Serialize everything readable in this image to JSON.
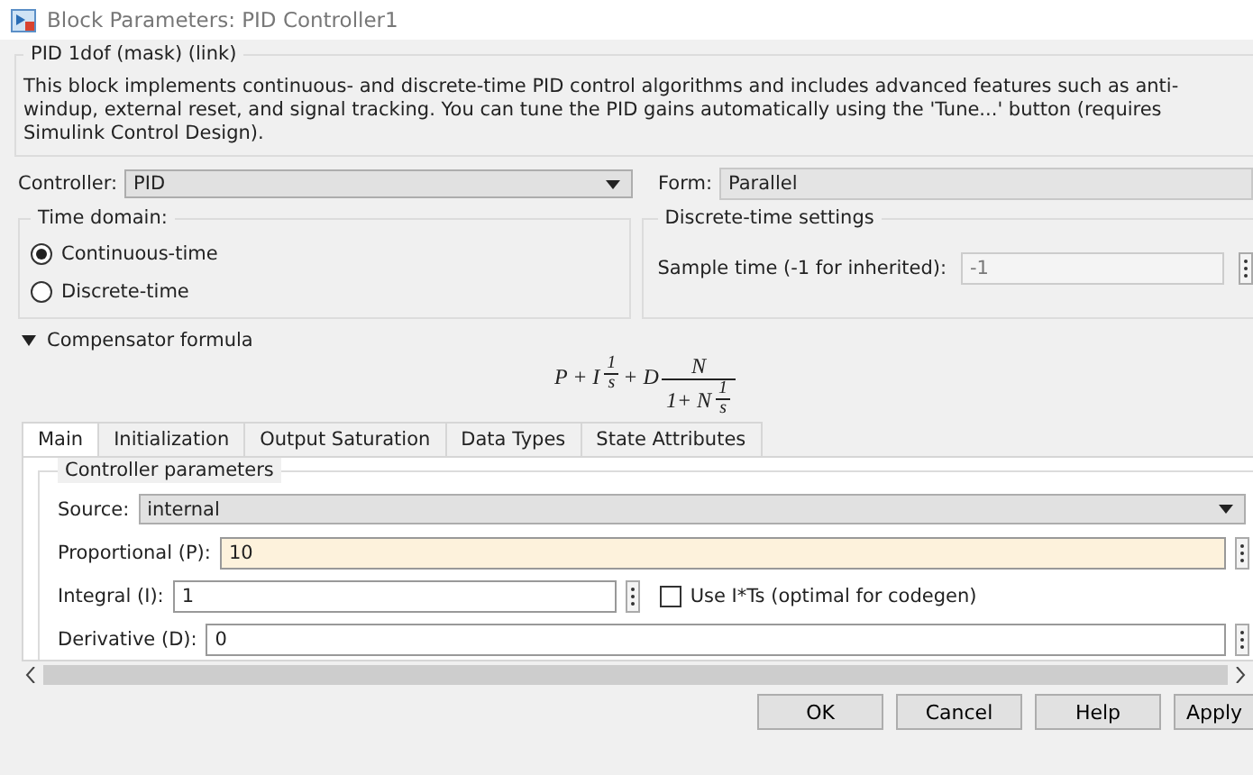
{
  "window": {
    "title": "Block Parameters: PID Controller1"
  },
  "description": {
    "title": "PID 1dof (mask) (link)",
    "text": "This block implements continuous- and discrete-time PID control algorithms and includes advanced features such as anti-windup, external reset, and signal tracking. You can tune the PID gains automatically using the 'Tune...' button (requires Simulink Control Design)."
  },
  "controller": {
    "label": "Controller:",
    "value": "PID"
  },
  "form": {
    "label": "Form:",
    "value": "Parallel"
  },
  "time_domain": {
    "title": "Time domain:",
    "options": [
      {
        "label": "Continuous-time",
        "selected": true
      },
      {
        "label": "Discrete-time",
        "selected": false
      }
    ]
  },
  "discrete_settings": {
    "title": "Discrete-time settings",
    "sample_time": {
      "label": "Sample time (-1 for inherited):",
      "value": "-1",
      "disabled": true
    }
  },
  "compensator": {
    "label": "Compensator formula",
    "expanded": true,
    "formula": [
      {
        "kind": "sym",
        "text": "P + I"
      },
      {
        "kind": "frac",
        "num": "1",
        "den": "s"
      },
      {
        "kind": "sym",
        "text": "+ D"
      },
      {
        "kind": "bigfrac",
        "num": "N",
        "den": [
          {
            "kind": "sym",
            "text": "1+ N"
          },
          {
            "kind": "frac",
            "num": "1",
            "den": "s"
          }
        ]
      }
    ]
  },
  "tabs": [
    {
      "label": "Main",
      "selected": true
    },
    {
      "label": "Initialization",
      "selected": false
    },
    {
      "label": "Output Saturation",
      "selected": false
    },
    {
      "label": "Data Types",
      "selected": false
    },
    {
      "label": "State Attributes",
      "selected": false
    }
  ],
  "main_tab": {
    "group_title": "Controller parameters",
    "source": {
      "label": "Source:",
      "value": "internal"
    },
    "parameters": [
      {
        "kind": "field",
        "label": "Proportional (P):",
        "value": "10",
        "highlighted": true
      },
      {
        "kind": "field_check",
        "label": "Integral (I):",
        "value": "1",
        "highlighted": false,
        "checkbox": {
          "label": "Use I*Ts (optimal for codegen)",
          "checked": false
        }
      },
      {
        "kind": "field",
        "label": "Derivative (D):",
        "value": "0",
        "highlighted": false
      }
    ]
  },
  "buttons": [
    {
      "label": "OK"
    },
    {
      "label": "Cancel"
    },
    {
      "label": "Help"
    },
    {
      "label": "Apply"
    }
  ]
}
